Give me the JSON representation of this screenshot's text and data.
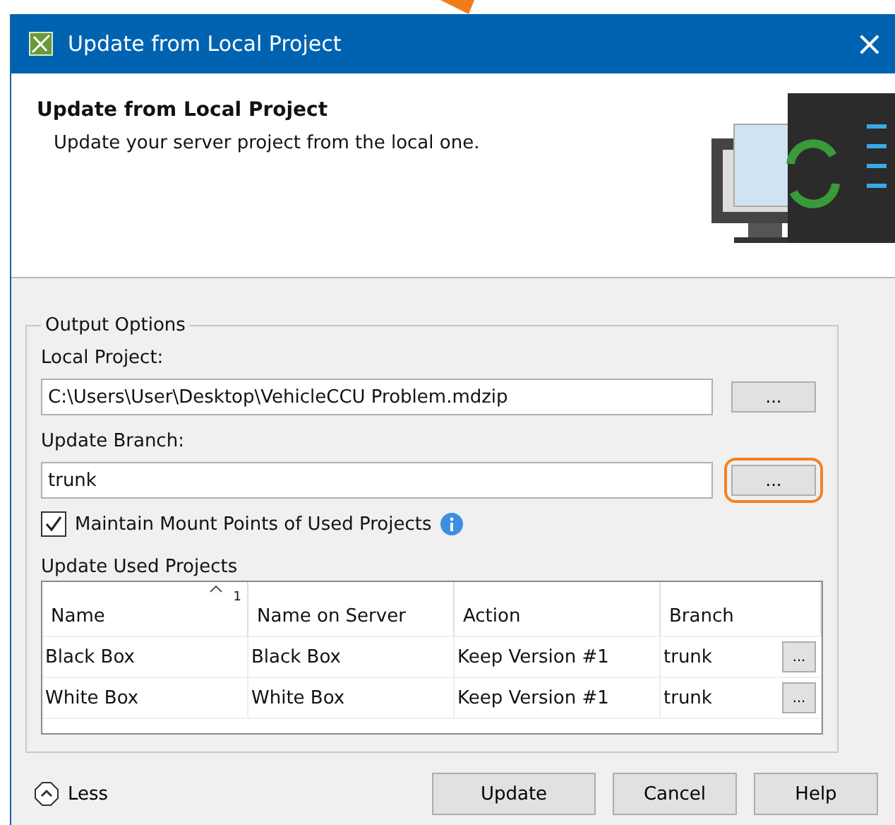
{
  "window": {
    "title": "Update from Local Project",
    "close": "×"
  },
  "header": {
    "title": "Update from Local Project",
    "subtitle": "Update your server project from the local one."
  },
  "group": {
    "title": "Output Options",
    "fields": [
      {
        "label": "Local Project:",
        "value": "C:\\Users\\User\\Desktop\\VehicleCCU Problem.mdzip",
        "browse": "...",
        "highlighted": false
      },
      {
        "label": "Update Branch:",
        "value": "trunk",
        "browse": "...",
        "highlighted": true
      }
    ],
    "checkbox": {
      "label": "Maintain Mount Points of Used Projects",
      "checked": true
    },
    "table_title": "Update Used Projects",
    "table": {
      "columns": [
        {
          "label": "Name",
          "sort_index": "1"
        },
        {
          "label": "Name on Server"
        },
        {
          "label": "Action"
        },
        {
          "label": "Branch"
        }
      ],
      "rows": [
        {
          "cells": [
            "Black Box",
            "Black Box",
            "Keep Version #1",
            "trunk"
          ],
          "browse": "..."
        },
        {
          "cells": [
            "White Box",
            "White Box",
            "Keep Version #1",
            "trunk"
          ],
          "browse": "..."
        }
      ]
    }
  },
  "footer": {
    "toggle": "Less",
    "buttons": [
      "Update",
      "Cancel",
      "Help"
    ]
  }
}
